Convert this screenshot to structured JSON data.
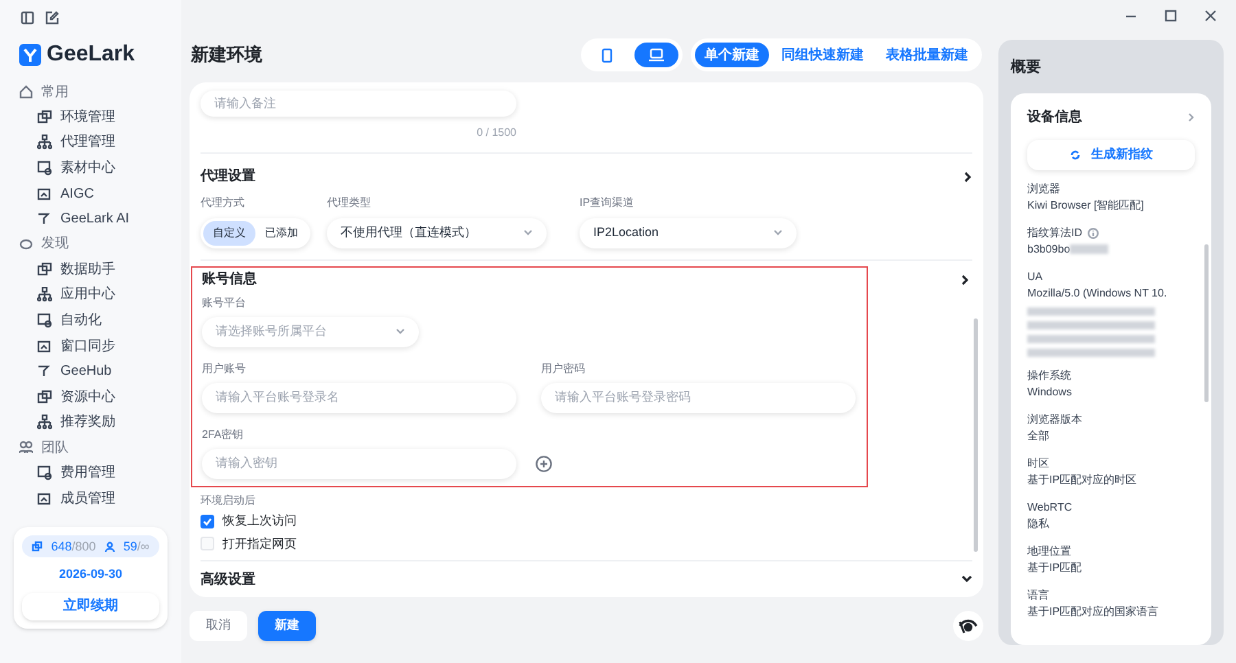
{
  "sidebar": {
    "brand": "GeeLark",
    "sections": [
      {
        "title": "常用",
        "items": [
          {
            "label": "环境管理"
          },
          {
            "label": "代理管理"
          },
          {
            "label": "素材中心"
          },
          {
            "label": "AIGC"
          },
          {
            "label": "GeeLark AI"
          }
        ]
      },
      {
        "title": "发现",
        "items": [
          {
            "label": "数据助手"
          },
          {
            "label": "应用中心"
          },
          {
            "label": "自动化"
          },
          {
            "label": "窗口同步"
          },
          {
            "label": "GeeHub"
          },
          {
            "label": "资源中心"
          },
          {
            "label": "推荐奖励"
          }
        ]
      },
      {
        "title": "团队",
        "items": [
          {
            "label": "费用管理"
          },
          {
            "label": "成员管理"
          }
        ]
      }
    ],
    "plan": {
      "devices_used": "648",
      "devices_total": "/800",
      "members_used": "59",
      "members_total": "/∞",
      "expiry": "2026-09-30",
      "renew_button": "立即续期"
    }
  },
  "main": {
    "title": "新建环境",
    "device_toggle": [
      {
        "kind": "phone",
        "selected": false
      },
      {
        "kind": "desktop",
        "selected": true
      }
    ],
    "create_tabs": [
      {
        "label": "单个新建",
        "selected": true
      },
      {
        "label": "同组快速新建",
        "selected": false
      },
      {
        "label": "表格批量新建",
        "selected": false
      }
    ],
    "note": {
      "placeholder": "请输入备注",
      "counter": "0 / 1500"
    },
    "proxy": {
      "title": "代理设置",
      "mode": {
        "label": "代理方式",
        "options": [
          {
            "label": "自定义",
            "selected": true
          },
          {
            "label": "已添加",
            "selected": false
          }
        ]
      },
      "type": {
        "label": "代理类型",
        "value": "不使用代理（直连模式）"
      },
      "ip_channel": {
        "label": "IP查询渠道",
        "value": "IP2Location"
      }
    },
    "account": {
      "title": "账号信息",
      "highlighted": true,
      "platform": {
        "label": "账号平台",
        "placeholder": "请选择账号所属平台"
      },
      "username": {
        "label": "用户账号",
        "placeholder": "请输入平台账号登录名"
      },
      "password": {
        "label": "用户密码",
        "placeholder": "请输入平台账号登录密码"
      },
      "twofa": {
        "label": "2FA密钥",
        "placeholder": "请输入密钥"
      }
    },
    "after_launch": {
      "label": "环境启动后",
      "options": [
        {
          "label": "恢复上次访问",
          "checked": true
        },
        {
          "label": "打开指定网页",
          "checked": false
        }
      ]
    },
    "advanced": {
      "title": "高级设置",
      "expanded": false
    },
    "buttons": {
      "cancel": "取消",
      "create": "新建"
    }
  },
  "summary": {
    "title": "概要",
    "device_info": {
      "title": "设备信息",
      "generate_button": "生成新指纹",
      "fields": [
        {
          "label": "浏览器",
          "value": "Kiwi Browser [智能匹配]",
          "kind": "plain"
        },
        {
          "label": "指纹算法ID",
          "value": "b3b09bo",
          "kind": "blurred_tail",
          "info": true
        },
        {
          "label": "UA",
          "value": "Mozilla/5.0 (Windows NT 10.",
          "kind": "blurred_lines"
        },
        {
          "label": "操作系统",
          "value": "Windows",
          "kind": "plain"
        },
        {
          "label": "浏览器版本",
          "value": "全部",
          "kind": "plain"
        },
        {
          "label": "时区",
          "value": "基于IP匹配对应的时区",
          "kind": "plain"
        },
        {
          "label": "WebRTC",
          "value": "隐私",
          "kind": "plain"
        },
        {
          "label": "地理位置",
          "value": "基于IP匹配",
          "kind": "plain"
        },
        {
          "label": "语言",
          "value": "基于IP匹配对应的国家语言",
          "kind": "plain"
        }
      ]
    }
  }
}
